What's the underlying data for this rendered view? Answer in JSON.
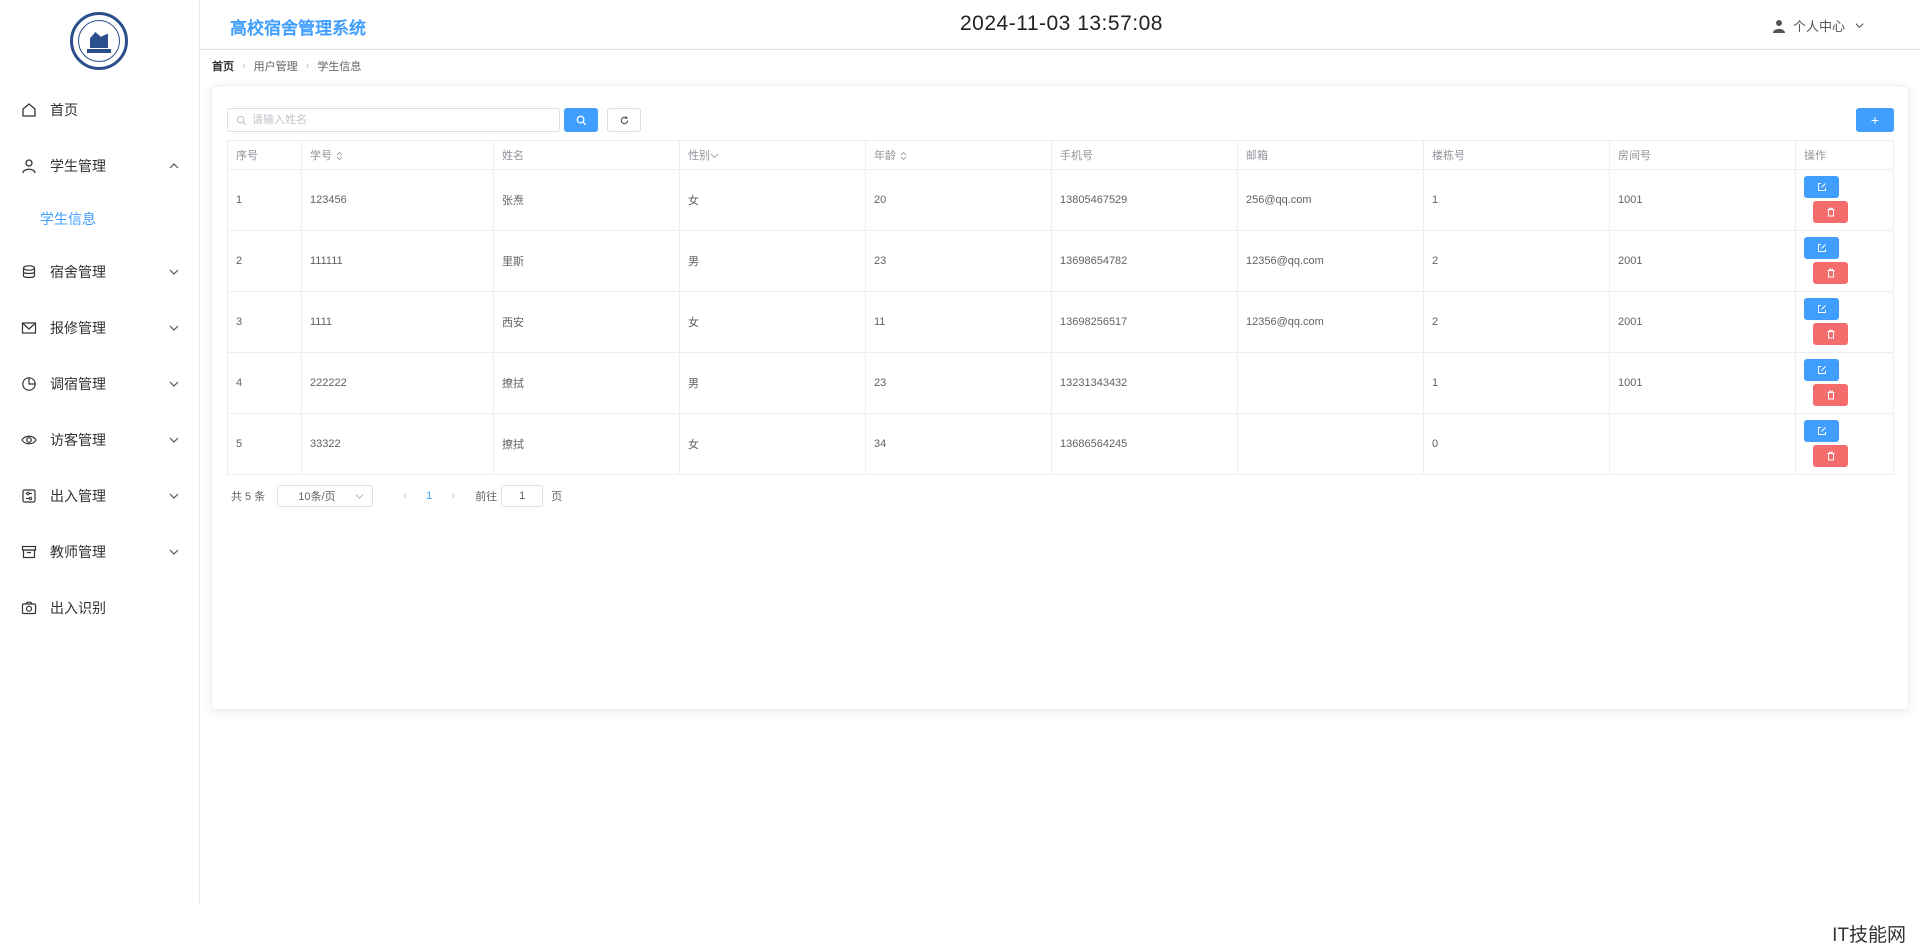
{
  "header": {
    "app_title": "高校宿舍管理系统",
    "datetime": "2024-11-03 13:57:08",
    "user_menu_label": "个人中心"
  },
  "sidebar": {
    "items": [
      {
        "label": "首页",
        "icon": "home-icon"
      },
      {
        "label": "学生管理",
        "icon": "user-icon",
        "expanded": true,
        "children": [
          {
            "label": "学生信息",
            "active": true
          }
        ]
      },
      {
        "label": "宿舍管理",
        "icon": "database-icon"
      },
      {
        "label": "报修管理",
        "icon": "mail-icon"
      },
      {
        "label": "调宿管理",
        "icon": "pie-chart-icon"
      },
      {
        "label": "访客管理",
        "icon": "eye-icon"
      },
      {
        "label": "出入管理",
        "icon": "sliders-icon"
      },
      {
        "label": "教师管理",
        "icon": "archive-icon"
      },
      {
        "label": "出入识别",
        "icon": "camera-icon"
      }
    ]
  },
  "breadcrumb": [
    "首页",
    "用户管理",
    "学生信息"
  ],
  "toolbar": {
    "search_placeholder": "请输入姓名",
    "search_value": "",
    "add_label": "+"
  },
  "table": {
    "columns": [
      "序号",
      "学号",
      "姓名",
      "性别",
      "年龄",
      "手机号",
      "邮箱",
      "楼栋号",
      "房间号",
      "操作"
    ],
    "rows": [
      [
        "1",
        "123456",
        "张焘",
        "女",
        "20",
        "13805467529",
        "256@qq.com",
        "1",
        "1001"
      ],
      [
        "2",
        "111111",
        "里斯",
        "男",
        "23",
        "13698654782",
        "12356@qq.com",
        "2",
        "2001"
      ],
      [
        "3",
        "1111",
        "西安",
        "女",
        "11",
        "13698256517",
        "12356@qq.com",
        "2",
        "2001"
      ],
      [
        "4",
        "222222",
        "撩拭",
        "男",
        "23",
        "13231343432",
        "",
        "1",
        "1001"
      ],
      [
        "5",
        "33322",
        "撩拭",
        "女",
        "34",
        "13686564245",
        "",
        "0",
        ""
      ]
    ]
  },
  "pagination": {
    "total_text": "共 5 条",
    "page_size": "10条/页",
    "current_page": "1",
    "goto_label": "前往",
    "goto_value": "1",
    "page_suffix": "页"
  },
  "watermark": "IT技能网",
  "colors": {
    "primary": "#409eff",
    "danger": "#f56c6c",
    "border": "#ebeef5"
  }
}
